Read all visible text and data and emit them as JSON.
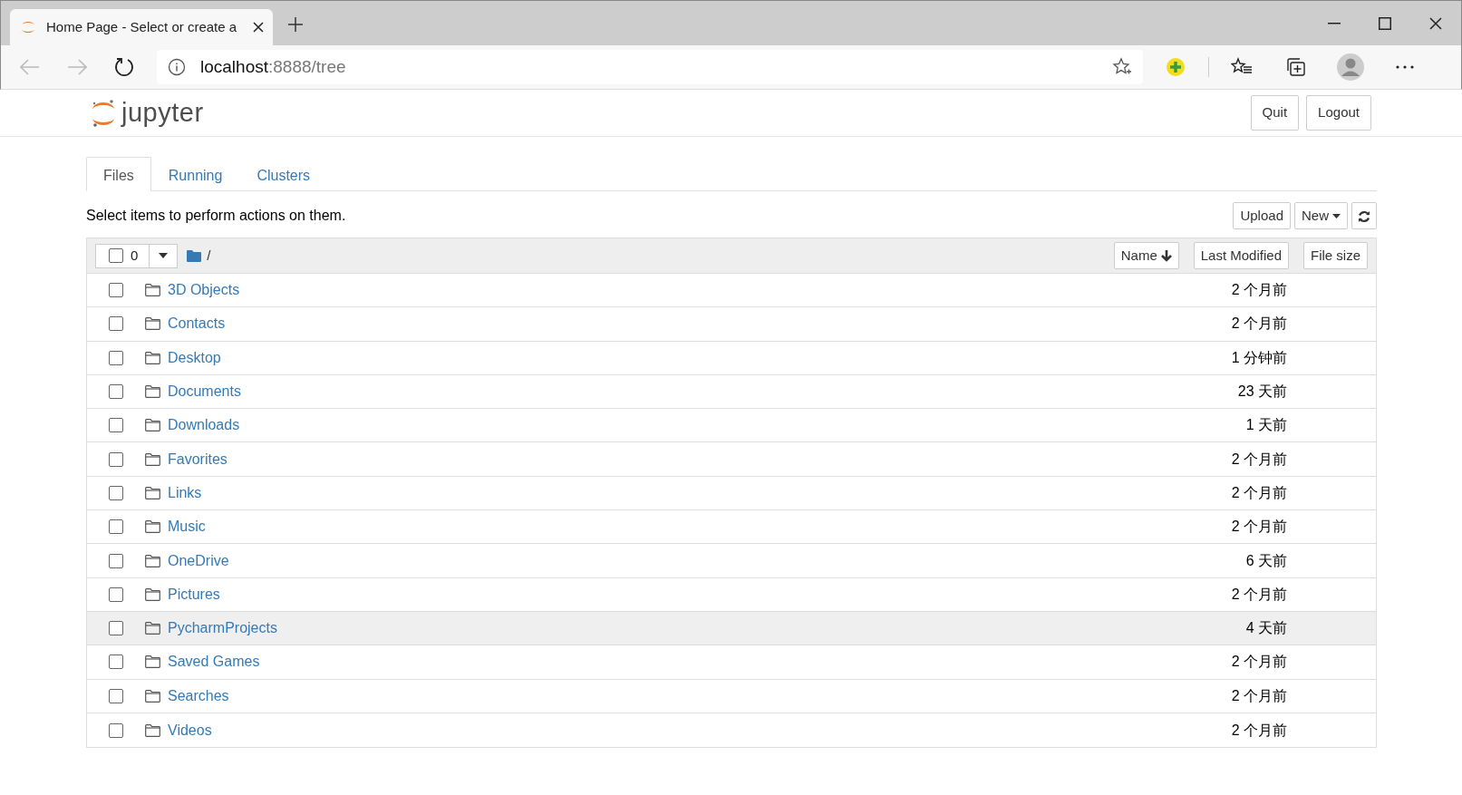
{
  "browser": {
    "tab_title": "Home Page - Select or create a",
    "address_host": "localhost",
    "address_rest": ":8888/tree"
  },
  "header": {
    "logo_text": "jupyter",
    "buttons": [
      "Quit",
      "Logout"
    ]
  },
  "tabs": [
    {
      "label": "Files",
      "selected": true
    },
    {
      "label": "Running",
      "selected": false
    },
    {
      "label": "Clusters",
      "selected": false
    }
  ],
  "toolbar": {
    "hint": "Select items to perform actions on them.",
    "buttons": [
      "Upload",
      "New"
    ]
  },
  "list_header": {
    "checked": false,
    "count": "0",
    "path": "/",
    "sort_buttons": [
      "Name",
      "Last Modified",
      "File size"
    ]
  },
  "rows": [
    {
      "name": "3D Objects",
      "modified": "2 个月前",
      "checked": false,
      "hovered": false
    },
    {
      "name": "Contacts",
      "modified": "2 个月前",
      "checked": false,
      "hovered": false
    },
    {
      "name": "Desktop",
      "modified": "1 分钟前",
      "checked": false,
      "hovered": false
    },
    {
      "name": "Documents",
      "modified": "23 天前",
      "checked": false,
      "hovered": false
    },
    {
      "name": "Downloads",
      "modified": "1 天前",
      "checked": false,
      "hovered": false
    },
    {
      "name": "Favorites",
      "modified": "2 个月前",
      "checked": false,
      "hovered": false
    },
    {
      "name": "Links",
      "modified": "2 个月前",
      "checked": false,
      "hovered": false
    },
    {
      "name": "Music",
      "modified": "2 个月前",
      "checked": false,
      "hovered": false
    },
    {
      "name": "OneDrive",
      "modified": "6 天前",
      "checked": false,
      "hovered": false
    },
    {
      "name": "Pictures",
      "modified": "2 个月前",
      "checked": false,
      "hovered": false
    },
    {
      "name": "PycharmProjects",
      "modified": "4 天前",
      "checked": false,
      "hovered": true
    },
    {
      "name": "Saved Games",
      "modified": "2 个月前",
      "checked": false,
      "hovered": false
    },
    {
      "name": "Searches",
      "modified": "2 个月前",
      "checked": false,
      "hovered": false
    },
    {
      "name": "Videos",
      "modified": "2 个月前",
      "checked": false,
      "hovered": false
    }
  ]
}
